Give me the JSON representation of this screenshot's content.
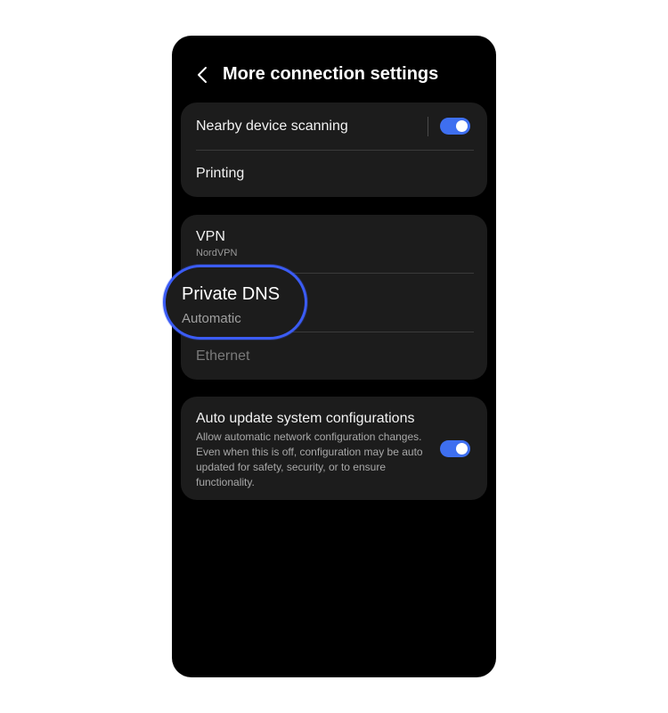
{
  "header": {
    "title": "More connection settings",
    "back_icon": "chevron-left-icon"
  },
  "group1": {
    "nearby_scanning": {
      "label": "Nearby device scanning",
      "toggle_on": true
    },
    "printing": {
      "label": "Printing"
    }
  },
  "group2": {
    "vpn": {
      "label": "VPN",
      "sub": "NordVPN"
    },
    "private_dns": {
      "label": "Private DNS",
      "sub": "Automatic"
    },
    "ethernet": {
      "label": "Ethernet"
    }
  },
  "group3": {
    "auto_update": {
      "label": "Auto update system configurations",
      "desc": "Allow automatic network configuration changes. Even when this is off, configuration may be auto updated for safety, security, or to ensure functionality.",
      "toggle_on": true
    }
  },
  "colors": {
    "accent": "#3e6ff0",
    "highlight_ring": "#3b5cf5",
    "card_bg": "#1c1c1c",
    "screen_bg": "#000000"
  }
}
